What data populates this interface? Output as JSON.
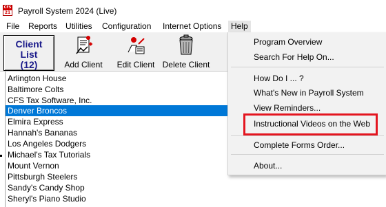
{
  "window": {
    "title": "Payroll System 2024 (Live)",
    "logo_top": "CFS",
    "logo_bottom": "21"
  },
  "menubar": {
    "items": [
      "File",
      "Reports",
      "Utilities",
      "Configuration",
      "Internet Options",
      "Help"
    ],
    "active": "Help"
  },
  "toolbar": {
    "client_list_line1": "Client",
    "client_list_line2": "List",
    "client_list_count": "(12)",
    "add_client": "Add Client",
    "edit_client": "Edit Client",
    "delete_client": "Delete Client"
  },
  "clients": {
    "items": [
      "Arlington House",
      "Baltimore Colts",
      "CFS Tax Software, Inc.",
      "Denver Broncos",
      "Elmira Express",
      "Hannah's Bananas",
      "Los Angeles Dodgers",
      "Michael's Tax Tutorials",
      "Mount Vernon",
      "Pittsburgh Steelers",
      "Sandy's Candy Shop",
      "Sheryl's Piano Studio"
    ],
    "selected": "Denver Broncos"
  },
  "help_menu": {
    "items": [
      "Program Overview",
      "Search For Help On...",
      "How Do I ... ?",
      "What's New in Payroll System",
      "View Reminders...",
      "Instructional Videos on the Web",
      "Complete Forms Order...",
      "About..."
    ],
    "highlighted": "Instructional Videos on the Web"
  },
  "colors": {
    "selection": "#0078d7",
    "highlight_box": "#e4151f",
    "client_list_text": "#1a1a8a"
  }
}
